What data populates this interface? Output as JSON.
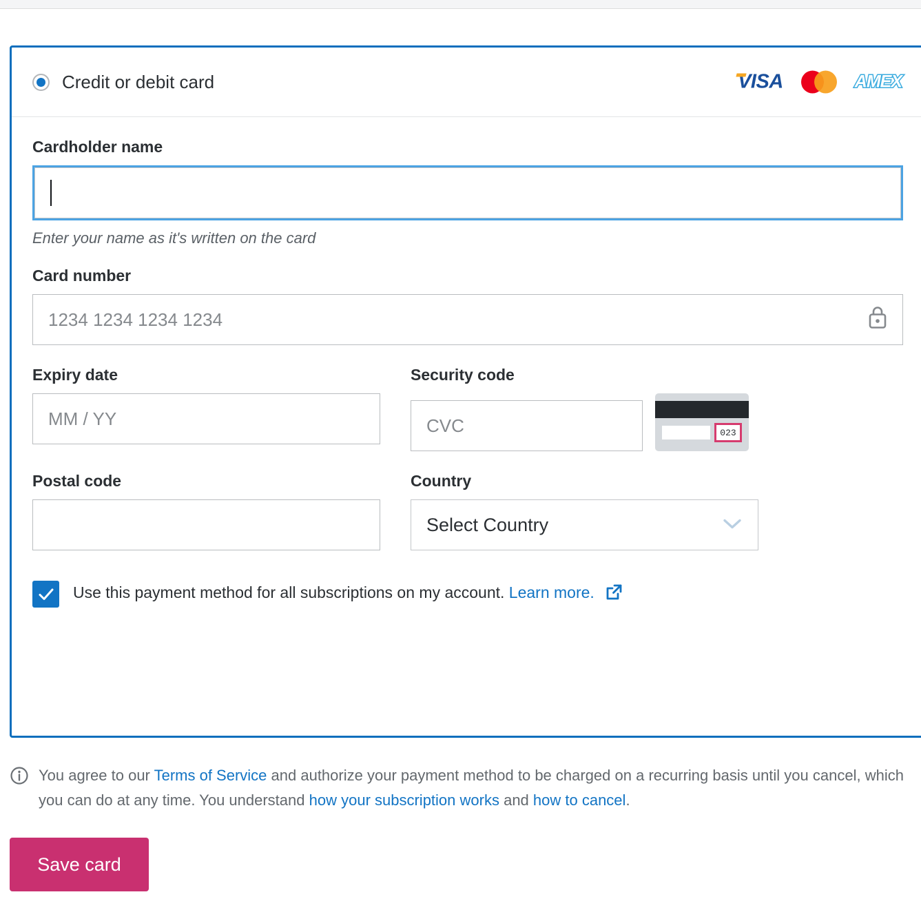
{
  "card_panel": {
    "payment_method_label": "Credit or debit card",
    "radio_selected": true,
    "brands": [
      {
        "name": "visa-logo",
        "text": "VISA"
      },
      {
        "name": "mastercard-logo",
        "text": ""
      },
      {
        "name": "amex-logo",
        "text": "AMEX"
      }
    ],
    "cardholder": {
      "label": "Cardholder name",
      "value": "",
      "placeholder": "",
      "hint": "Enter your name as it's written on the card",
      "focused": true
    },
    "card_number": {
      "label": "Card number",
      "value": "",
      "placeholder": "1234 1234 1234 1234",
      "icon": "lock-icon"
    },
    "expiry": {
      "label": "Expiry date",
      "value": "",
      "placeholder": "MM / YY"
    },
    "security_code": {
      "label": "Security code",
      "value": "",
      "placeholder": "CVC",
      "illustration_digits": "023"
    },
    "postal_code": {
      "label": "Postal code",
      "value": "",
      "placeholder": ""
    },
    "country": {
      "label": "Country",
      "selected": "Select Country"
    },
    "subscription_checkbox": {
      "checked": true,
      "text": "Use this payment method for all subscriptions on my account.",
      "link_label": "Learn more.",
      "link_icon": "external-link-icon"
    }
  },
  "terms": {
    "icon": "info-icon",
    "part1": "You agree to our ",
    "link1": "Terms of Service",
    "part2": " and authorize your payment method to be charged on a recurring basis until you cancel, which you can do at any time. You understand ",
    "link2": "how your subscription works",
    "part3": " and ",
    "link3": "how to cancel",
    "part4": "."
  },
  "actions": {
    "save_label": "Save card"
  },
  "colors": {
    "accent_blue": "#1274c4",
    "card_border_blue": "#0a6ebd",
    "save_magenta": "#c93070",
    "link_blue": "#1274c4",
    "cvc_highlight": "#d63b6e"
  }
}
